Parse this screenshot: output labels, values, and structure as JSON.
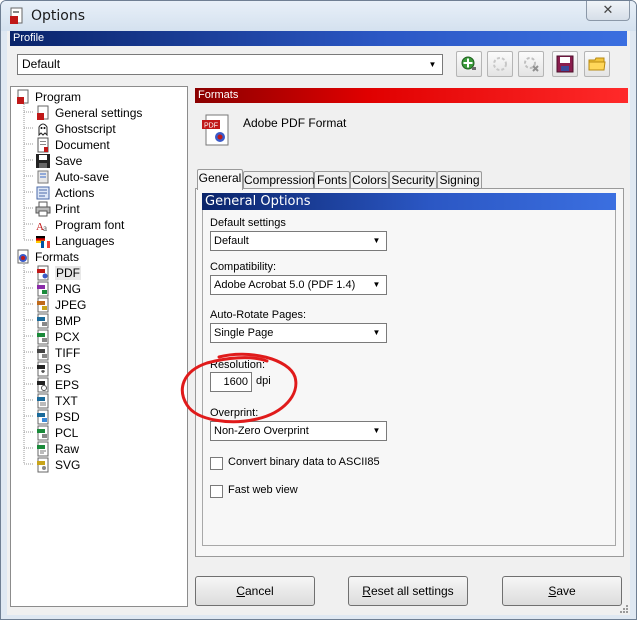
{
  "window": {
    "title": "Options",
    "close_glyph": "✕"
  },
  "profile": {
    "header": "Profile",
    "selected": "Default",
    "toolbar_icons": [
      "add-profile-icon",
      "rename-profile-icon",
      "delete-profile-icon",
      "save-profile-icon",
      "open-profile-icon"
    ]
  },
  "tree": {
    "program": {
      "label": "Program",
      "items": [
        "General settings",
        "Ghostscript",
        "Document",
        "Save",
        "Auto-save",
        "Actions",
        "Print",
        "Program font",
        "Languages"
      ]
    },
    "formats": {
      "label": "Formats",
      "items": [
        "PDF",
        "PNG",
        "JPEG",
        "BMP",
        "PCX",
        "TIFF",
        "PS",
        "EPS",
        "TXT",
        "PSD",
        "PCL",
        "Raw",
        "SVG"
      ],
      "selected": "PDF"
    }
  },
  "formats_panel": {
    "header": "Formats",
    "title": "Adobe PDF Format",
    "tabs": [
      "General",
      "Compression",
      "Fonts",
      "Colors",
      "Security",
      "Signing"
    ],
    "active_tab": "General"
  },
  "general_options": {
    "header": "General Options",
    "default_settings_label": "Default settings",
    "default_settings_value": "Default",
    "compatibility_label": "Compatibility:",
    "compatibility_value": "Adobe Acrobat 5.0 (PDF 1.4)",
    "autorotate_label": "Auto-Rotate Pages:",
    "autorotate_value": "Single Page",
    "resolution_label": "Resolution:",
    "resolution_value": "1600",
    "resolution_unit": "dpi",
    "overprint_label": "Overprint:",
    "overprint_value": "Non-Zero Overprint",
    "ascii85_label": "Convert binary data to ASCII85",
    "ascii85_checked": false,
    "fastweb_label": "Fast web view",
    "fastweb_checked": false
  },
  "buttons": {
    "cancel_mnemonic": "C",
    "cancel_rest": "ancel",
    "reset_mnemonic": "R",
    "reset_rest": "eset all settings",
    "save_mnemonic": "S",
    "save_rest": "ave"
  },
  "annotation": {
    "color": "#e01b1b"
  }
}
